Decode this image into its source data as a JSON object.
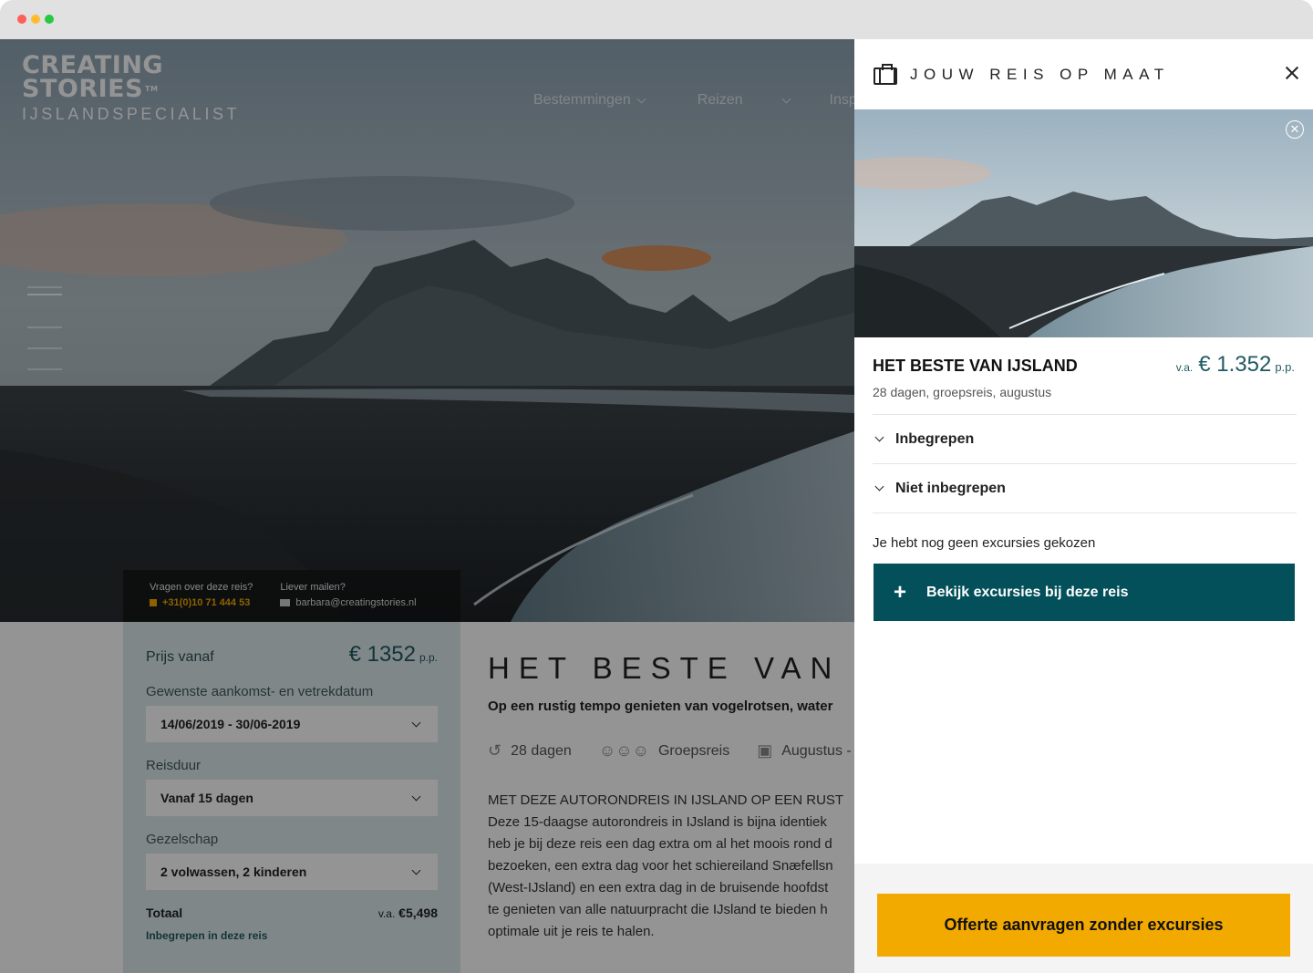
{
  "brand": {
    "line1": "CREATING",
    "line2": "STORIES",
    "tm": "TM",
    "line3": "IJSLANDSPECIALIST"
  },
  "nav": [
    {
      "label": "Bestemmingen"
    },
    {
      "label": "Reizen"
    },
    {
      "label": "Insp"
    }
  ],
  "contact": {
    "phone_question": "Vragen over deze reis?",
    "phone": "+31(0)10 71 444 53",
    "mail_question": "Liever mailen?",
    "email": "barbara@creatingstories.nl"
  },
  "booking": {
    "price_label": "Prijs vanaf",
    "price": "€ 1352",
    "price_unit": "p.p.",
    "date_label": "Gewenste aankomst- en vetrekdatum",
    "date_value": "14/06/2019 - 30/06-2019",
    "duration_label": "Reisduur",
    "duration_value": "Vanaf 15 dagen",
    "party_label": "Gezelschap",
    "party_value": "2 volwassen, 2 kinderen",
    "total_label": "Totaal",
    "total_prefix": "v.a.",
    "total_value": "€5,498",
    "included_link": "Inbegrepen in deze reis"
  },
  "main": {
    "title": "HET BESTE VAN I",
    "subtitle": "Op een rustig tempo genieten van vogelrotsen, water",
    "facts": [
      {
        "icon": "history-icon",
        "label": "28 dagen"
      },
      {
        "icon": "group-icon",
        "label": "Groepsreis"
      },
      {
        "icon": "calendar-icon",
        "label": "Augustus - D"
      }
    ],
    "body_lines": [
      "MET DEZE AUTORONDREIS IN IJSLAND OP EEN RUST",
      "Deze 15-daagse autorondreis in IJsland is bijna identiek",
      "heb je bij deze reis een dag extra om al het moois rond d",
      "bezoeken, een extra dag voor het schiereiland Snæfellsn",
      "(West-IJsland) en een extra dag in de bruisende hoofdst",
      "te genieten van alle natuurpracht die IJsland te bieden h",
      "optimale uit je reis te halen."
    ]
  },
  "drawer": {
    "title": "JOUW REIS OP MAAT",
    "trip_name": "HET BESTE VAN IJSLAND",
    "price_prefix": "v.a.",
    "price": "€ 1.352",
    "price_unit": "p.p.",
    "trip_meta": "28 dagen, groepsreis, augustus",
    "accordion": [
      {
        "label": "Inbegrepen"
      },
      {
        "label": "Niet inbegrepen"
      }
    ],
    "no_excursions": "Je hebt nog geen excursies gekozen",
    "excursions_button": "Bekijk excursies bij deze reis",
    "quote_button": "Offerte aanvragen zonder excursies"
  },
  "colors": {
    "accent_teal": "#03505a",
    "accent_orange": "#f2a900",
    "panel_bg": "#dce9ec"
  }
}
